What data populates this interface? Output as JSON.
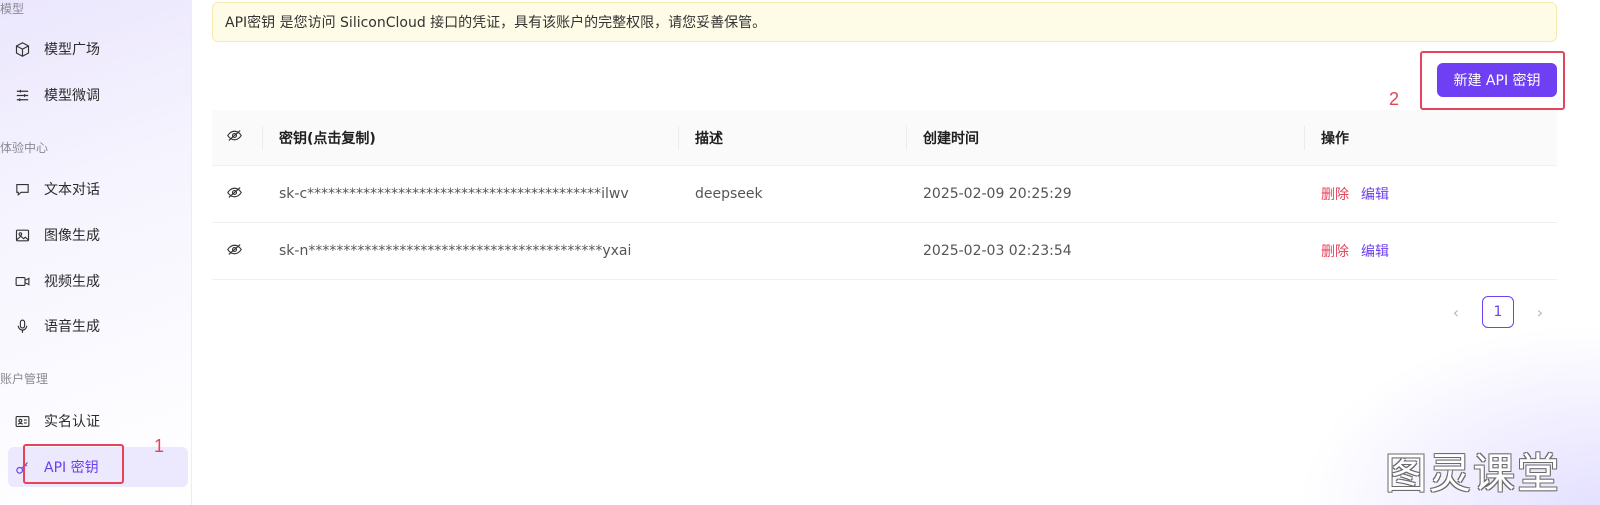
{
  "sidebar": {
    "sections": [
      {
        "label": "模型"
      },
      {
        "label": "体验中心"
      },
      {
        "label": "账户管理"
      }
    ],
    "items": [
      {
        "label": "模型广场",
        "icon": "cube-icon"
      },
      {
        "label": "模型微调",
        "icon": "sliders-icon"
      },
      {
        "label": "文本对话",
        "icon": "chat-bubble-icon"
      },
      {
        "label": "图像生成",
        "icon": "image-icon"
      },
      {
        "label": "视频生成",
        "icon": "video-icon"
      },
      {
        "label": "语音生成",
        "icon": "microphone-icon"
      },
      {
        "label": "实名认证",
        "icon": "id-card-icon"
      },
      {
        "label": "API 密钥",
        "icon": "key-icon",
        "active": true
      }
    ]
  },
  "notice": {
    "text": "API密钥 是您访问 SiliconCloud 接口的凭证，具有该账户的完整权限，请您妥善保管。"
  },
  "toolbar": {
    "new_key_label": "新建 API 密钥"
  },
  "table": {
    "columns": {
      "key": "密钥(点击复制)",
      "description": "描述",
      "created": "创建时间",
      "actions": "操作"
    },
    "rows": [
      {
        "key": "sk-c******************************************ilwv",
        "description": "deepseek",
        "created": "2025-02-09 20:25:29",
        "delete": "删除",
        "edit": "编辑"
      },
      {
        "key": "sk-n******************************************yxai",
        "description": "",
        "created": "2025-02-03 02:23:54",
        "delete": "删除",
        "edit": "编辑"
      }
    ]
  },
  "pagination": {
    "current": "1",
    "prev": "‹",
    "next": "›"
  },
  "annotations": {
    "sidebar_marker": "1",
    "button_marker": "2"
  },
  "watermark": {
    "text": "图灵课堂"
  },
  "colors": {
    "accent": "#6e3ff3",
    "danger": "#e5435a",
    "notice_bg": "#fefbe6",
    "annotation": "#e5435a"
  }
}
